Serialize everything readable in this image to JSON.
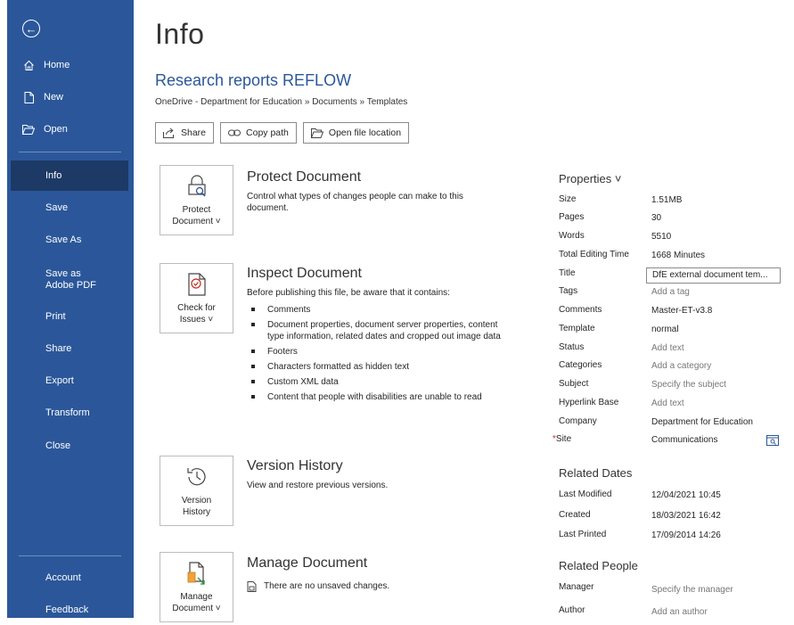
{
  "sidebar": {
    "back_label": "←",
    "items": [
      {
        "label": "Home",
        "icon": "home-icon"
      },
      {
        "label": "New",
        "icon": "new-document-icon"
      },
      {
        "label": "Open",
        "icon": "open-folder-icon"
      },
      {
        "label": "Info",
        "selected": true
      },
      {
        "label": "Save"
      },
      {
        "label": "Save As"
      },
      {
        "label": "Save as Adobe PDF"
      },
      {
        "label": "Print"
      },
      {
        "label": "Share"
      },
      {
        "label": "Export"
      },
      {
        "label": "Transform"
      },
      {
        "label": "Close"
      }
    ],
    "bottom_items": [
      {
        "label": "Account"
      },
      {
        "label": "Feedback"
      }
    ]
  },
  "page": {
    "title": "Info",
    "doc_name": "Research reports REFLOW",
    "doc_path": "OneDrive - Department for Education » Documents » Templates"
  },
  "actions": {
    "share": "Share",
    "copy_path": "Copy path",
    "open_location": "Open file location"
  },
  "sections": {
    "protect": {
      "tile_label_1": "Protect",
      "tile_label_2": "Document ˅",
      "title": "Protect Document",
      "desc": "Control what types of changes people can make to this document."
    },
    "inspect": {
      "tile_label_1": "Check for",
      "tile_label_2": "Issues ˅",
      "title": "Inspect Document",
      "desc": "Before publishing this file, be aware that it contains:",
      "bullets": [
        "Comments",
        "Document properties, document server properties, content type information, related dates and cropped out image data",
        "Footers",
        "Characters formatted as hidden text",
        "Custom XML data",
        "Content that people with disabilities are unable to read"
      ]
    },
    "version": {
      "tile_label_1": "Version",
      "tile_label_2": "History",
      "title": "Version History",
      "desc": "View and restore previous versions."
    },
    "manage": {
      "tile_label_1": "Manage",
      "tile_label_2": "Document ˅",
      "title": "Manage Document",
      "desc": "There are no unsaved changes."
    }
  },
  "properties": {
    "heading": "Properties ˅",
    "rows": [
      {
        "label": "Size",
        "value": "1.51MB"
      },
      {
        "label": "Pages",
        "value": "30"
      },
      {
        "label": "Words",
        "value": "5510"
      },
      {
        "label": "Total Editing Time",
        "value": "1668 Minutes"
      },
      {
        "label": "Title",
        "value": "DfE external document tem..."
      },
      {
        "label": "Tags",
        "value": "Add a tag"
      },
      {
        "label": "Comments",
        "value": "Master-ET-v3.8"
      },
      {
        "label": "Template",
        "value": "normal"
      },
      {
        "label": "Status",
        "value": "Add text"
      },
      {
        "label": "Categories",
        "value": "Add a category"
      },
      {
        "label": "Subject",
        "value": "Specify the subject"
      },
      {
        "label": "Hyperlink Base",
        "value": "Add text"
      },
      {
        "label": "Company",
        "value": "Department for Education"
      },
      {
        "label": "Site",
        "value": "Communications",
        "required_mark": "*"
      }
    ]
  },
  "related_dates": {
    "heading": "Related Dates",
    "rows": [
      {
        "label": "Last Modified",
        "value": "12/04/2021 10:45"
      },
      {
        "label": "Created",
        "value": "18/03/2021 16:42"
      },
      {
        "label": "Last Printed",
        "value": "17/09/2014 14:26"
      }
    ]
  },
  "related_people": {
    "heading": "Related People",
    "rows": [
      {
        "label": "Manager",
        "value": "Specify the manager"
      },
      {
        "label": "Author",
        "value": "Add an author"
      }
    ]
  },
  "colors": {
    "sidebar": "#2b579a",
    "sidebar_selected": "#1c3a65",
    "accent": "#2b579a",
    "required": "#c42b1c"
  }
}
